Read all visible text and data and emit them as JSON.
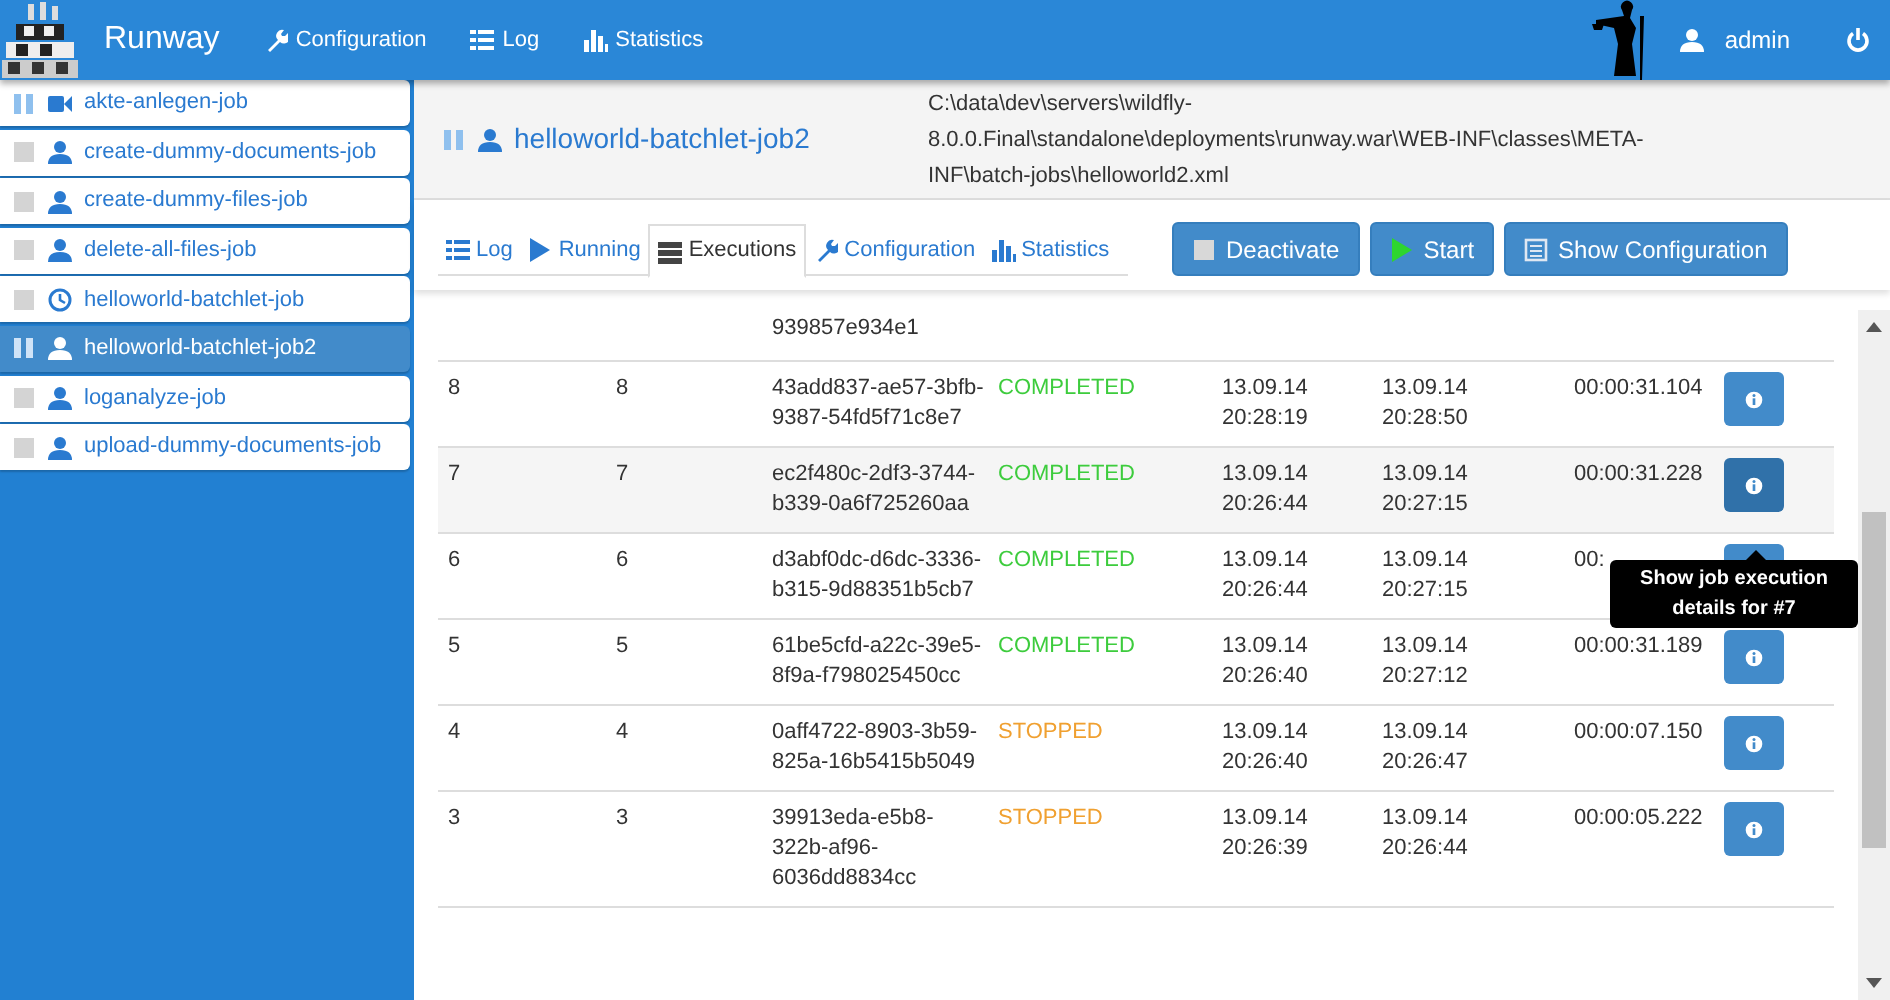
{
  "navbar": {
    "brand": "Runway",
    "links": [
      {
        "label": "Configuration"
      },
      {
        "label": "Log"
      },
      {
        "label": "Statistics"
      }
    ],
    "user": "admin"
  },
  "sidebar": {
    "items": [
      {
        "label": "akte-anlegen-job",
        "active": true,
        "kind": "camera",
        "selected": false
      },
      {
        "label": "create-dummy-documents-job",
        "active": false,
        "kind": "user",
        "selected": false
      },
      {
        "label": "create-dummy-files-job",
        "active": false,
        "kind": "user",
        "selected": false
      },
      {
        "label": "delete-all-files-job",
        "active": false,
        "kind": "user",
        "selected": false
      },
      {
        "label": "helloworld-batchlet-job",
        "active": false,
        "kind": "clock",
        "selected": false
      },
      {
        "label": "helloworld-batchlet-job2",
        "active": true,
        "kind": "user",
        "selected": true
      },
      {
        "label": "loganalyze-job",
        "active": false,
        "kind": "user",
        "selected": false
      },
      {
        "label": "upload-dummy-documents-job",
        "active": false,
        "kind": "user",
        "selected": false
      }
    ]
  },
  "job": {
    "title": "helloworld-batchlet-job2",
    "active": true,
    "kind": "user",
    "path": "C:\\data\\dev\\servers\\wildfly-8.0.0.Final\\standalone\\deployments\\runway.war\\WEB-INF\\classes\\META-INF\\batch-jobs\\helloworld2.xml"
  },
  "tabs": [
    {
      "label": "Log",
      "selected": false
    },
    {
      "label": "Running",
      "selected": false
    },
    {
      "label": "Executions",
      "selected": true
    },
    {
      "label": "Configuration",
      "selected": false
    },
    {
      "label": "Statistics",
      "selected": false
    }
  ],
  "buttons": [
    {
      "label": "Deactivate"
    },
    {
      "label": "Start"
    },
    {
      "label": "Show Configuration"
    }
  ],
  "table": {
    "rows": [
      {
        "uuid": "939857e934e1"
      },
      {
        "column_1": "8",
        "column_2": "8",
        "uuid": "43add837-ae57-3bfb-9387-54fd5f71c8e7",
        "status": "COMPLETED",
        "start": "13.09.14 20:28:19",
        "end": "13.09.14 20:28:50",
        "duration": "00:00:31.104",
        "hovered": false
      },
      {
        "column_1": "7",
        "column_2": "7",
        "uuid": "ec2f480c-2df3-3744-b339-0a6f725260aa",
        "status": "COMPLETED",
        "start": "13.09.14 20:26:44",
        "end": "13.09.14 20:27:15",
        "duration": "00:00:31.228",
        "hovered": true
      },
      {
        "column_1": "6",
        "column_2": "6",
        "uuid": "d3abf0dc-d6dc-3336-b315-9d88351b5cb7",
        "status": "COMPLETED",
        "start": "13.09.14 20:26:44",
        "end": "13.09.14 20:27:15",
        "duration": "00:",
        "hovered": false
      },
      {
        "column_1": "5",
        "column_2": "5",
        "uuid": "61be5cfd-a22c-39e5-8f9a-f798025450cc",
        "status": "COMPLETED",
        "start": "13.09.14 20:26:40",
        "end": "13.09.14 20:27:12",
        "duration": "00:00:31.189",
        "hovered": false
      },
      {
        "column_1": "4",
        "column_2": "4",
        "uuid": "0aff4722-8903-3b59-825a-16b5415b5049",
        "status": "STOPPED",
        "start": "13.09.14 20:26:40",
        "end": "13.09.14 20:26:47",
        "duration": "00:00:07.150",
        "hovered": false
      },
      {
        "column_1": "3",
        "column_2": "3",
        "uuid": "39913eda-e5b8-322b-af96-6036dd8834cc",
        "status": "STOPPED",
        "start": "13.09.14 20:26:39",
        "end": "13.09.14 20:26:44",
        "duration": "00:00:05.222",
        "hovered": false
      }
    ]
  },
  "tooltip": "Show job execution details for #7"
}
